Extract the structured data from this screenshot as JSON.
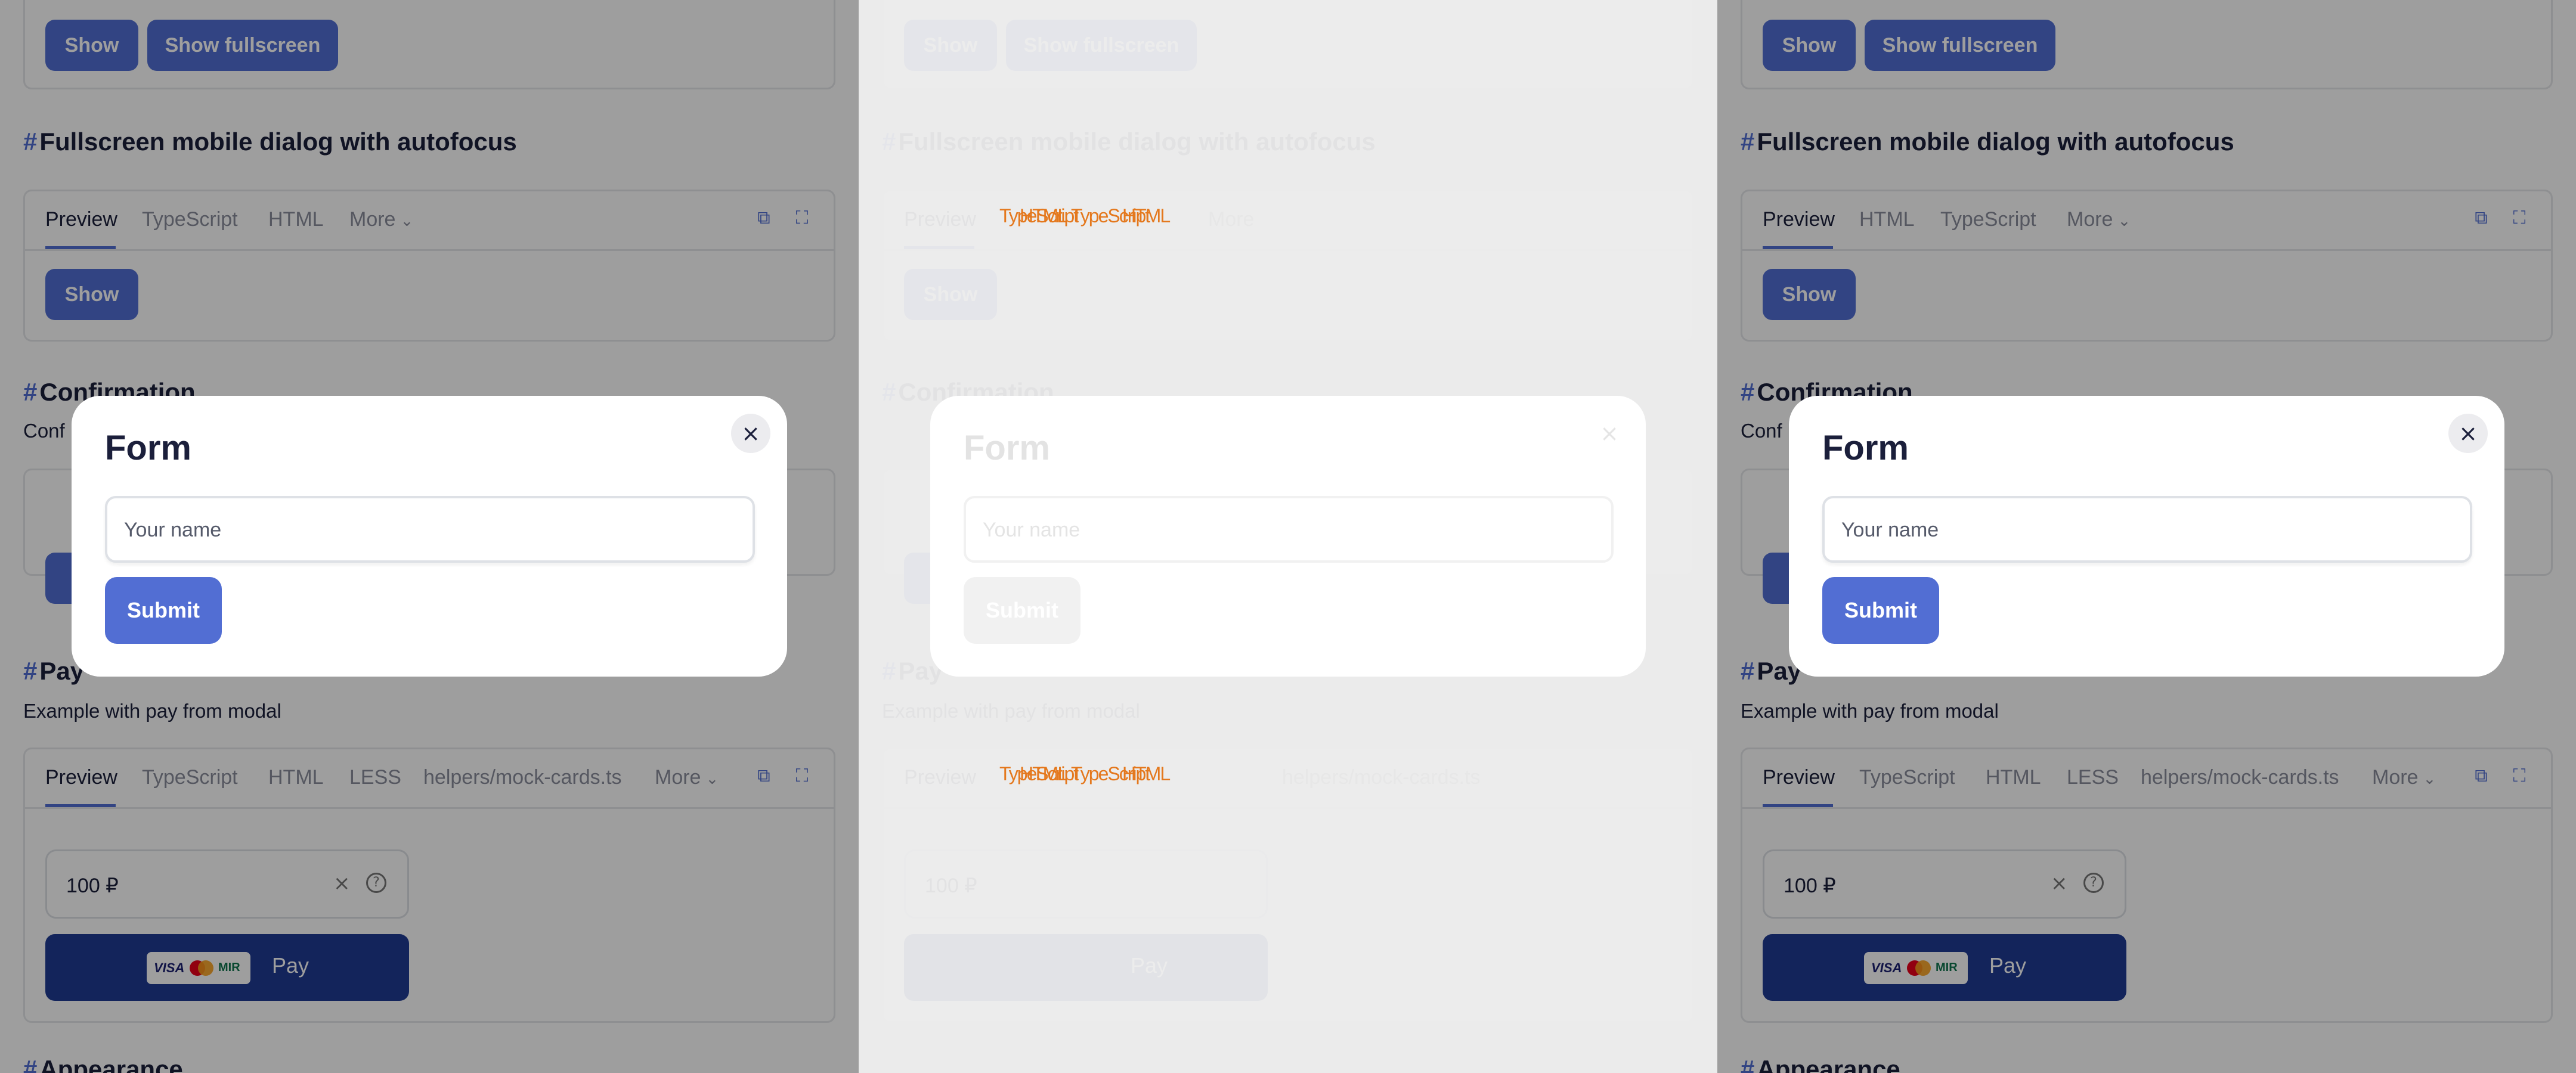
{
  "buttons": {
    "show": "Show",
    "show_fullscreen": "Show fullscreen"
  },
  "headings": {
    "hash": "#",
    "fullscreen_mobile": "Fullscreen mobile dialog with autofocus",
    "confirmation": "Confirmation",
    "confirmation_desc": "Conf",
    "pay": "Pay",
    "pay_desc": "Example with pay from modal",
    "appearance": "Appearance"
  },
  "tabs_fullscreen": {
    "preview": "Preview",
    "second": "TypeScript",
    "third": "HTML",
    "more": "More"
  },
  "tabs_fullscreen_alt": {
    "preview": "Preview",
    "second": "HTML",
    "third": "TypeScript",
    "more": "More"
  },
  "tabs_pay": {
    "preview": "Preview",
    "typescript": "TypeScript",
    "html": "HTML",
    "less": "LESS",
    "mock": "helpers/mock-cards.ts",
    "more": "More"
  },
  "pay_block": {
    "amount": "100 ₽",
    "pay_label": "Pay",
    "card_visa": "VISA",
    "card_mir": "MIR"
  },
  "modal": {
    "title": "Form",
    "close_glyph": "×",
    "name_placeholder": "Your name",
    "submit": "Submit"
  },
  "glitch_text": [
    "TypeScript",
    "HTML",
    "TypeScript",
    "HTML"
  ],
  "colors": {
    "accent": "#526ed3",
    "pay_button": "#1f3b94",
    "heading": "#1b1f3b",
    "glitch": "#e4781d"
  }
}
